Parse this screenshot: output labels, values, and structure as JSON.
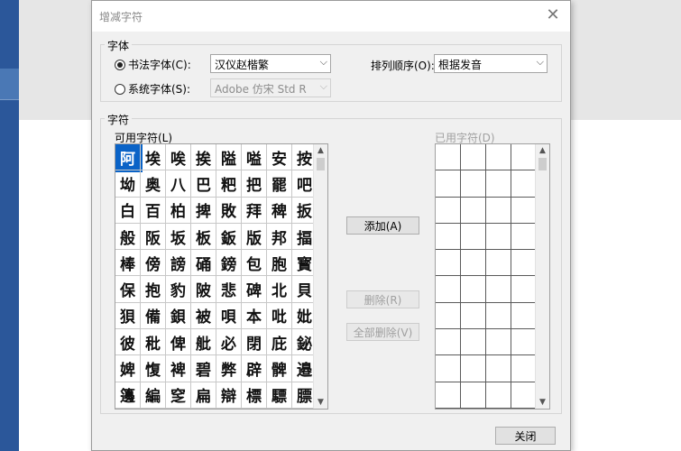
{
  "dialog": {
    "title": "增减字符",
    "close_icon": "close-icon"
  },
  "font_group": {
    "label": "字体",
    "calligraphy_radio": "书法字体(C):",
    "calligraphy_value": "汉仪赵楷繁",
    "system_radio": "系统字体(S):",
    "system_value": "Adobe 仿宋 Std R",
    "sort_label": "排列顺序(O):",
    "sort_value": "根据发音"
  },
  "chars_group": {
    "label": "字符",
    "available_label": "可用字符(L)",
    "used_label": "已用字符(D)",
    "available_chars": [
      [
        "阿",
        "埃",
        "唉",
        "挨",
        "隘",
        "嗌",
        "安",
        "按"
      ],
      [
        "坳",
        "奥",
        "八",
        "巴",
        "粑",
        "把",
        "罷",
        "吧"
      ],
      [
        "白",
        "百",
        "柏",
        "捭",
        "敗",
        "拜",
        "稗",
        "扳"
      ],
      [
        "般",
        "阪",
        "坂",
        "板",
        "鈑",
        "版",
        "邦",
        "揊"
      ],
      [
        "棒",
        "傍",
        "謗",
        "硧",
        "鎊",
        "包",
        "胞",
        "寳"
      ],
      [
        "保",
        "抱",
        "豹",
        "陂",
        "悲",
        "碑",
        "北",
        "貝"
      ],
      [
        "狽",
        "備",
        "鋇",
        "被",
        "唄",
        "本",
        "吡",
        "妣"
      ],
      [
        "彼",
        "秕",
        "俾",
        "舭",
        "必",
        "閉",
        "庇",
        "鉍"
      ],
      [
        "婢",
        "愎",
        "裨",
        "碧",
        "弊",
        "辟",
        "髀",
        "邉"
      ],
      [
        "籩",
        "編",
        "窆",
        "扁",
        "辯",
        "標",
        "驃",
        "膘"
      ]
    ]
  },
  "buttons": {
    "add": "添加(A)",
    "delete": "删除(R)",
    "delete_all": "全部删除(V)",
    "close": "关闭"
  },
  "icons": {
    "dropdown": "chevron-down-icon",
    "scroll_up": "scroll-up-icon",
    "scroll_down": "scroll-down-icon"
  }
}
